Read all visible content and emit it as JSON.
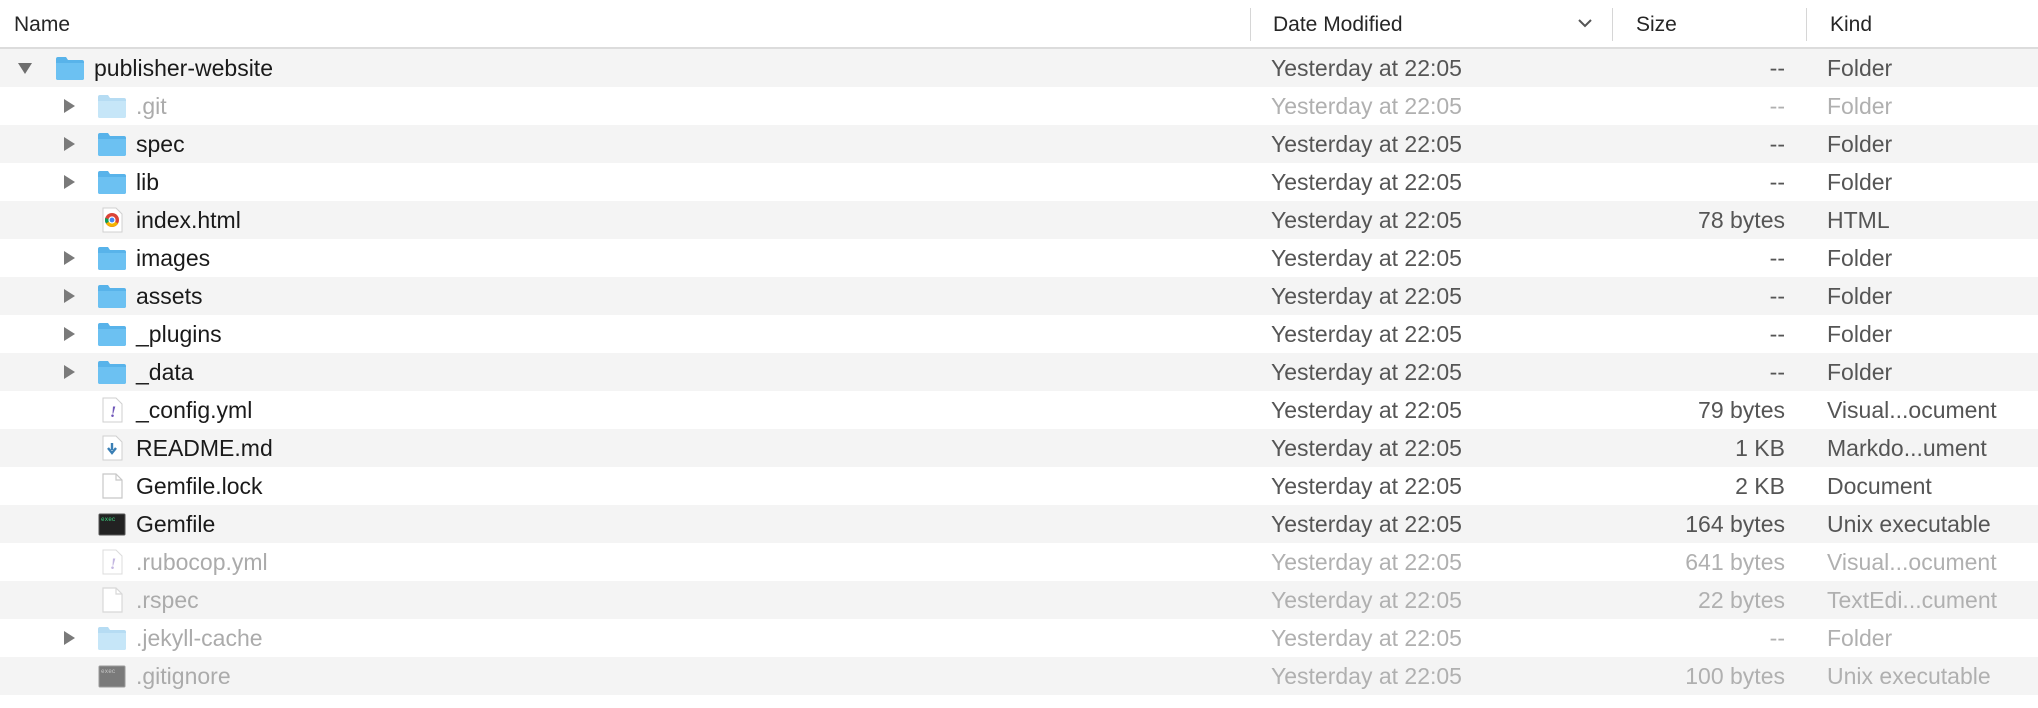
{
  "columns": {
    "name": "Name",
    "date_modified": "Date Modified",
    "size": "Size",
    "kind": "Kind"
  },
  "colors": {
    "folder": "#6cc1f2",
    "folder_light": "#c6e6f8",
    "alt_row": "#f4f4f4",
    "dim_text": "#ababab"
  },
  "rows": [
    {
      "name": "publisher-website",
      "date": "Yesterday at 22:05",
      "size": "--",
      "kind": "Folder",
      "icon": "folder-icon",
      "disclosure": "expanded",
      "level": 0,
      "dim": false
    },
    {
      "name": ".git",
      "date": "Yesterday at 22:05",
      "size": "--",
      "kind": "Folder",
      "icon": "folder-icon",
      "disclosure": "collapsed",
      "level": 1,
      "dim": true
    },
    {
      "name": "spec",
      "date": "Yesterday at 22:05",
      "size": "--",
      "kind": "Folder",
      "icon": "folder-icon",
      "disclosure": "collapsed",
      "level": 1,
      "dim": false
    },
    {
      "name": "lib",
      "date": "Yesterday at 22:05",
      "size": "--",
      "kind": "Folder",
      "icon": "folder-icon",
      "disclosure": "collapsed",
      "level": 1,
      "dim": false
    },
    {
      "name": "index.html",
      "date": "Yesterday at 22:05",
      "size": "78 bytes",
      "kind": "HTML",
      "icon": "chrome-html-icon",
      "disclosure": "none",
      "level": 1,
      "dim": false
    },
    {
      "name": "images",
      "date": "Yesterday at 22:05",
      "size": "--",
      "kind": "Folder",
      "icon": "folder-icon",
      "disclosure": "collapsed",
      "level": 1,
      "dim": false
    },
    {
      "name": "assets",
      "date": "Yesterday at 22:05",
      "size": "--",
      "kind": "Folder",
      "icon": "folder-icon",
      "disclosure": "collapsed",
      "level": 1,
      "dim": false
    },
    {
      "name": "_plugins",
      "date": "Yesterday at 22:05",
      "size": "--",
      "kind": "Folder",
      "icon": "folder-icon",
      "disclosure": "collapsed",
      "level": 1,
      "dim": false
    },
    {
      "name": "_data",
      "date": "Yesterday at 22:05",
      "size": "--",
      "kind": "Folder",
      "icon": "folder-icon",
      "disclosure": "collapsed",
      "level": 1,
      "dim": false
    },
    {
      "name": "_config.yml",
      "date": "Yesterday at 22:05",
      "size": "79 bytes",
      "kind": "Visual...ocument",
      "icon": "yaml-file-icon",
      "disclosure": "none",
      "level": 1,
      "dim": false
    },
    {
      "name": "README.md",
      "date": "Yesterday at 22:05",
      "size": "1 KB",
      "kind": "Markdo...ument",
      "icon": "markdown-file-icon",
      "disclosure": "none",
      "level": 1,
      "dim": false
    },
    {
      "name": "Gemfile.lock",
      "date": "Yesterday at 22:05",
      "size": "2 KB",
      "kind": "Document",
      "icon": "document-icon",
      "disclosure": "none",
      "level": 1,
      "dim": false
    },
    {
      "name": "Gemfile",
      "date": "Yesterday at 22:05",
      "size": "164 bytes",
      "kind": "Unix executable",
      "icon": "terminal-exec-icon",
      "disclosure": "none",
      "level": 1,
      "dim": false
    },
    {
      "name": ".rubocop.yml",
      "date": "Yesterday at 22:05",
      "size": "641 bytes",
      "kind": "Visual...ocument",
      "icon": "yaml-file-icon",
      "disclosure": "none",
      "level": 1,
      "dim": true
    },
    {
      "name": ".rspec",
      "date": "Yesterday at 22:05",
      "size": "22 bytes",
      "kind": "TextEdi...cument",
      "icon": "document-icon",
      "disclosure": "none",
      "level": 1,
      "dim": true
    },
    {
      "name": ".jekyll-cache",
      "date": "Yesterday at 22:05",
      "size": "--",
      "kind": "Folder",
      "icon": "folder-icon",
      "disclosure": "collapsed",
      "level": 1,
      "dim": true
    },
    {
      "name": ".gitignore",
      "date": "Yesterday at 22:05",
      "size": "100 bytes",
      "kind": "Unix executable",
      "icon": "terminal-exec-icon",
      "disclosure": "none",
      "level": 1,
      "dim": true
    }
  ]
}
